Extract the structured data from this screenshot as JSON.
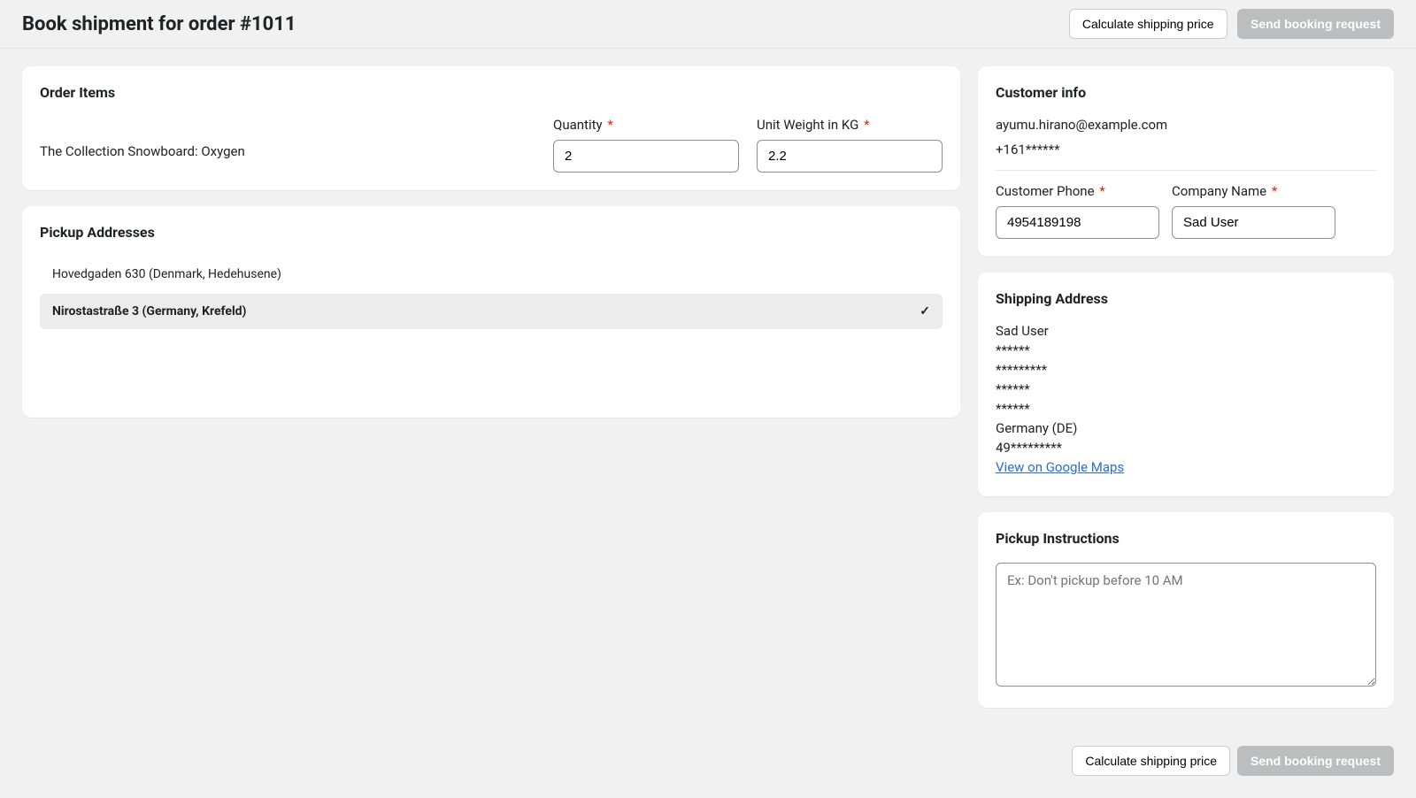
{
  "header": {
    "title": "Book shipment for order #1011",
    "calc_label": "Calculate shipping price",
    "send_label": "Send booking request"
  },
  "order_items": {
    "title": "Order Items",
    "quantity_label": "Quantity",
    "weight_label": "Unit Weight in KG",
    "item": {
      "name": "The Collection Snowboard: Oxygen",
      "quantity": "2",
      "weight": "2.2"
    }
  },
  "pickup": {
    "title": "Pickup Addresses",
    "options": [
      {
        "label": "Hovedgaden 630 (Denmark, Hedehusene)",
        "selected": false
      },
      {
        "label": "Nirostastraße 3 (Germany, Krefeld)",
        "selected": true
      }
    ]
  },
  "customer": {
    "title": "Customer info",
    "email": "ayumu.hirano@example.com",
    "phone_masked": "+161******",
    "phone_label": "Customer Phone",
    "phone_value": "4954189198",
    "company_label": "Company Name",
    "company_value": "Sad User"
  },
  "shipping": {
    "title": "Shipping Address",
    "lines": [
      "Sad User",
      "******",
      "*********",
      "******",
      "******",
      "Germany (DE)",
      "49*********"
    ],
    "maps_label": "View on Google Maps"
  },
  "instructions": {
    "title": "Pickup Instructions",
    "placeholder": "Ex: Don't pickup before 10 AM"
  },
  "footer": {
    "calc_label": "Calculate shipping price",
    "send_label": "Send booking request"
  }
}
